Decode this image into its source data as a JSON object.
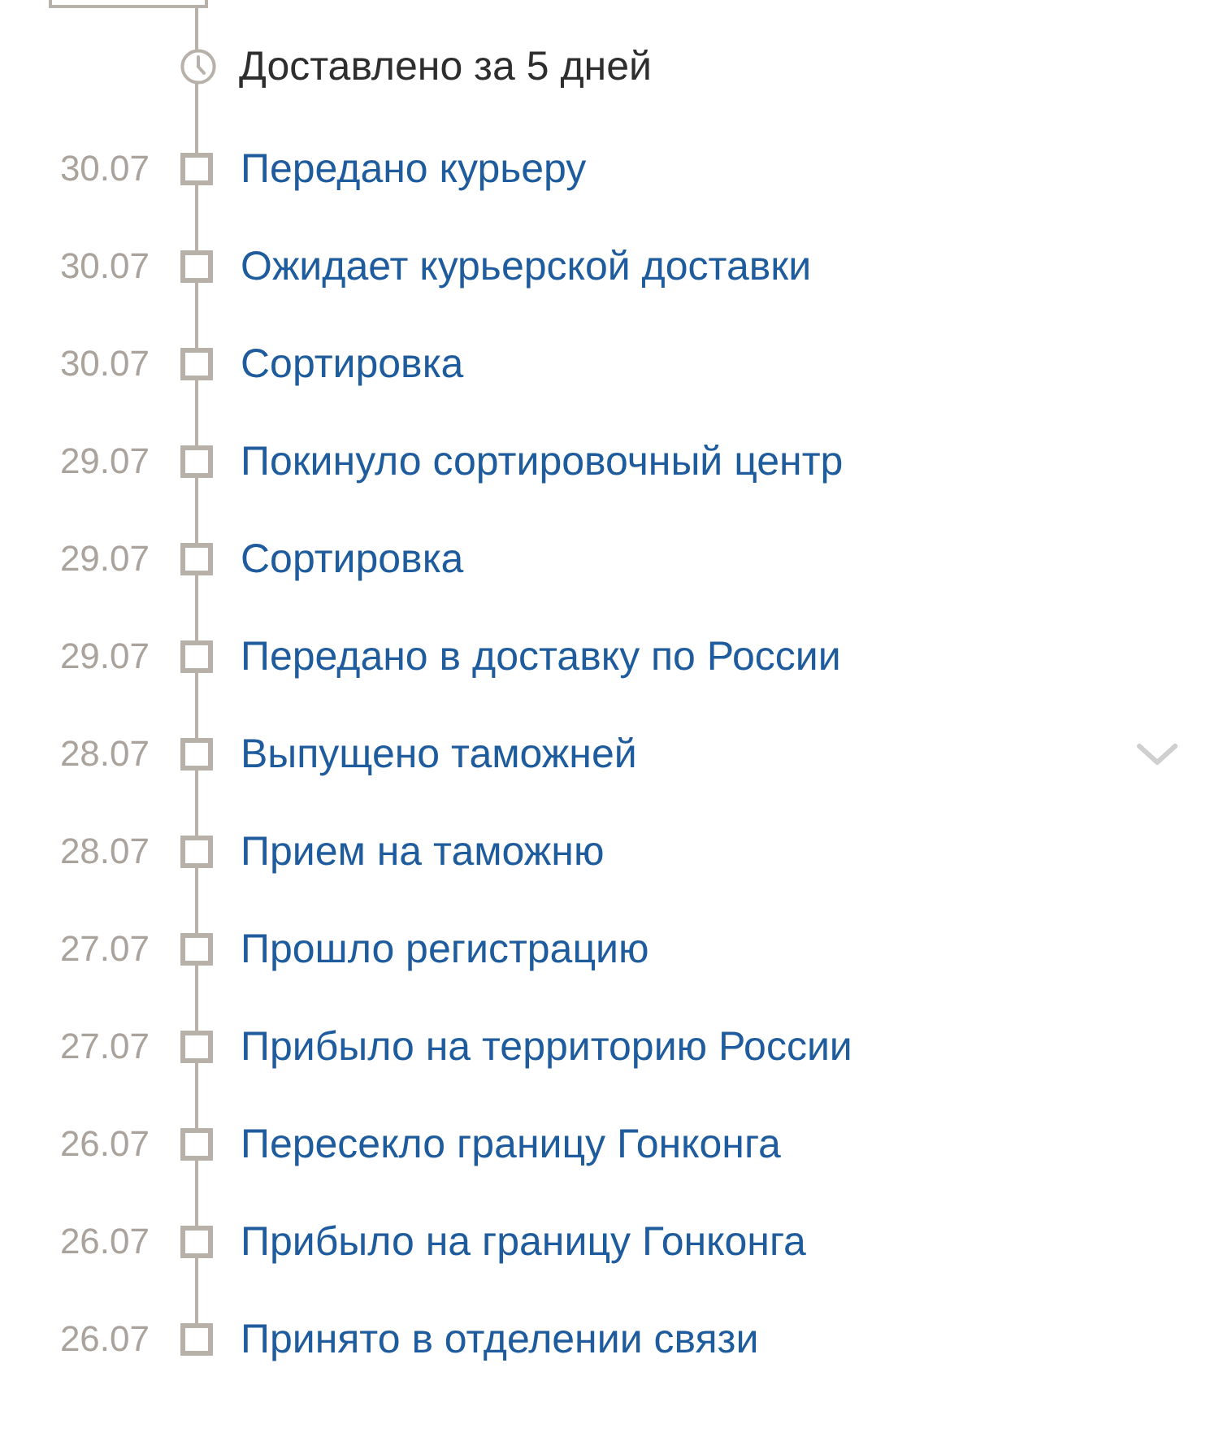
{
  "summary": {
    "text": "Доставлено за 5 дней"
  },
  "events": [
    {
      "date": "30.07",
      "label": "Передано курьеру"
    },
    {
      "date": "30.07",
      "label": "Ожидает курьерской доставки"
    },
    {
      "date": "30.07",
      "label": "Сортировка"
    },
    {
      "date": "29.07",
      "label": "Покинуло сортировочный центр"
    },
    {
      "date": "29.07",
      "label": "Сортировка"
    },
    {
      "date": "29.07",
      "label": "Передано в доставку по России"
    },
    {
      "date": "28.07",
      "label": "Выпущено таможней",
      "toggle": {
        "expanded": false
      }
    },
    {
      "date": "28.07",
      "label": "Прием на таможню"
    },
    {
      "date": "27.07",
      "label": "Прошло регистрацию"
    },
    {
      "date": "27.07",
      "label": "Прибыло на территорию России"
    },
    {
      "date": "26.07",
      "label": "Пересекло границу Гонконга"
    },
    {
      "date": "26.07",
      "label": "Прибыло на границу Гонконга"
    },
    {
      "date": "26.07",
      "label": "Принято в отделении связи"
    }
  ]
}
